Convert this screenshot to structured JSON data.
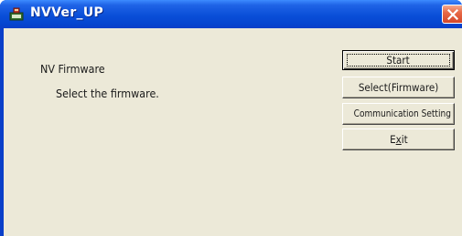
{
  "window": {
    "title": "NVVer_UP",
    "title_color": "#ffffff",
    "titlebar_color": "#0a4fd8",
    "close_button_color": "#e86a47"
  },
  "icons": {
    "app": "app-icon",
    "close": "close-icon"
  },
  "content": {
    "heading": "NV Firmware",
    "message": "Select the firmware."
  },
  "buttons": {
    "start": "Start",
    "select_firmware": "Select(Firmware)",
    "communication_setting": "Communication Setting",
    "exit_before": "E",
    "exit_mnemonic": "x",
    "exit_after": "it"
  }
}
